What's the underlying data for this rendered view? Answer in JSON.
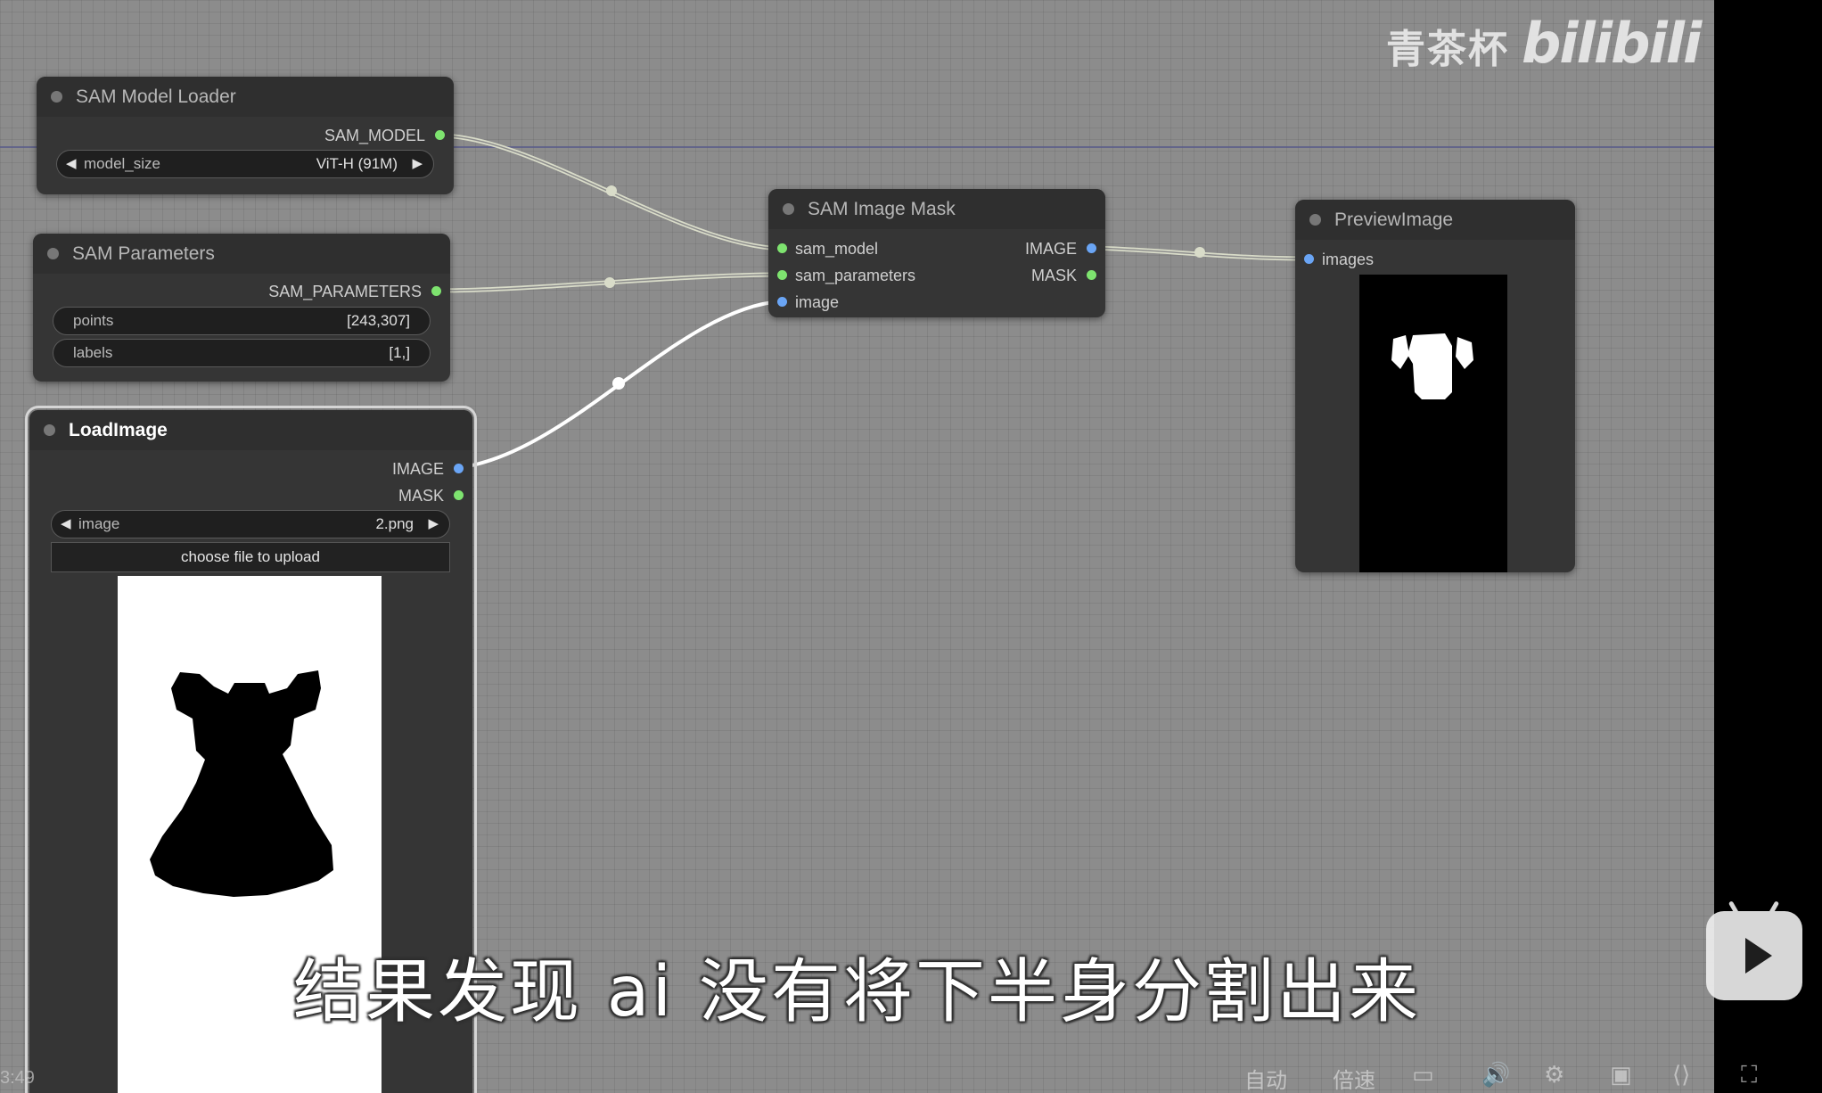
{
  "watermark": {
    "channel": "青茶杯",
    "brand": "bilibili"
  },
  "nodes": {
    "sam_model_loader": {
      "title": "SAM Model Loader",
      "output": "SAM_MODEL",
      "widget": {
        "label": "model_size",
        "value": "ViT-H (91M)"
      }
    },
    "sam_parameters": {
      "title": "SAM Parameters",
      "output": "SAM_PARAMETERS",
      "widgets": [
        {
          "label": "points",
          "value": "[243,307]"
        },
        {
          "label": "labels",
          "value": "[1,]"
        }
      ]
    },
    "load_image": {
      "title": "LoadImage",
      "outputs": [
        "IMAGE",
        "MASK"
      ],
      "widget": {
        "label": "image",
        "value": "2.png"
      },
      "upload_button": "choose file to upload"
    },
    "sam_image_mask": {
      "title": "SAM Image Mask",
      "inputs": [
        "sam_model",
        "sam_parameters",
        "image"
      ],
      "outputs": [
        "IMAGE",
        "MASK"
      ]
    },
    "preview_image": {
      "title": "PreviewImage",
      "input": "images"
    }
  },
  "subtitle": "结果发现 ai 没有将下半身分割出来",
  "player": {
    "timecode": "3:49",
    "auto_label": "自动",
    "speed_label": "倍速"
  },
  "colors": {
    "canvas": "#8c8c8c",
    "node_body": "#353535",
    "pin_green": "#7ee36f",
    "pin_blue": "#6aa5f5",
    "link": "#e8ecd9",
    "player_bar": "#000000"
  },
  "icons": [
    "danmaku-icon",
    "volume-icon",
    "settings-icon",
    "pip-icon",
    "widescreen-icon",
    "fullscreen-icon",
    "bilibili-tv-icon"
  ]
}
